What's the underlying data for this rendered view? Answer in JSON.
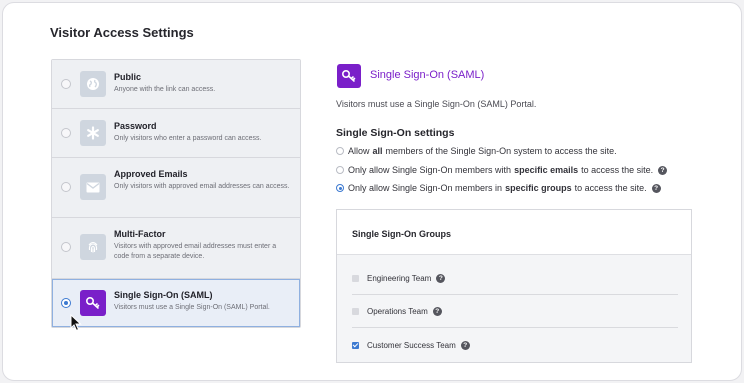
{
  "page": {
    "title": "Visitor Access Settings"
  },
  "options": [
    {
      "name": "Public",
      "desc": "Anyone with the link can access.",
      "icon": "globe-icon",
      "selected": false
    },
    {
      "name": "Password",
      "desc": "Only visitors who enter a password can access.",
      "icon": "asterisk-icon",
      "selected": false
    },
    {
      "name": "Approved Emails",
      "desc": "Only visitors with approved email addresses can access.",
      "icon": "envelope-icon",
      "selected": false
    },
    {
      "name": "Multi-Factor",
      "desc": "Visitors with approved email addresses must enter a code from a separate device.",
      "icon": "fingerprint-icon",
      "selected": false
    },
    {
      "name": "Single Sign-On (SAML)",
      "desc": "Visitors must use a Single Sign-On (SAML) Portal.",
      "icon": "key-icon",
      "selected": true
    }
  ],
  "detail": {
    "heading": "Single Sign-On (SAML)",
    "subtitle": "Visitors must use a Single Sign-On (SAML) Portal.",
    "settings_title": "Single Sign-On settings",
    "choices": [
      {
        "pre": "Allow",
        "bold": "all",
        "post": "members of the Single Sign-On system to access the site.",
        "selected": false,
        "help": false
      },
      {
        "pre": "Only allow Single Sign-On members with",
        "bold": "specific emails",
        "post": "to access the site.",
        "selected": false,
        "help": true
      },
      {
        "pre": "Only allow Single Sign-On members in",
        "bold": "specific groups",
        "post": "to access the site.",
        "selected": true,
        "help": true
      }
    ],
    "help_glyph": "?",
    "groups_title": "Single Sign-On Groups",
    "groups": [
      {
        "name": "Engineering Team",
        "checked": false
      },
      {
        "name": "Operations Team",
        "checked": false
      },
      {
        "name": "Customer Success Team",
        "checked": true
      }
    ]
  },
  "colors": {
    "accent": "#7a1fc9",
    "selection": "#3d7ad1"
  }
}
